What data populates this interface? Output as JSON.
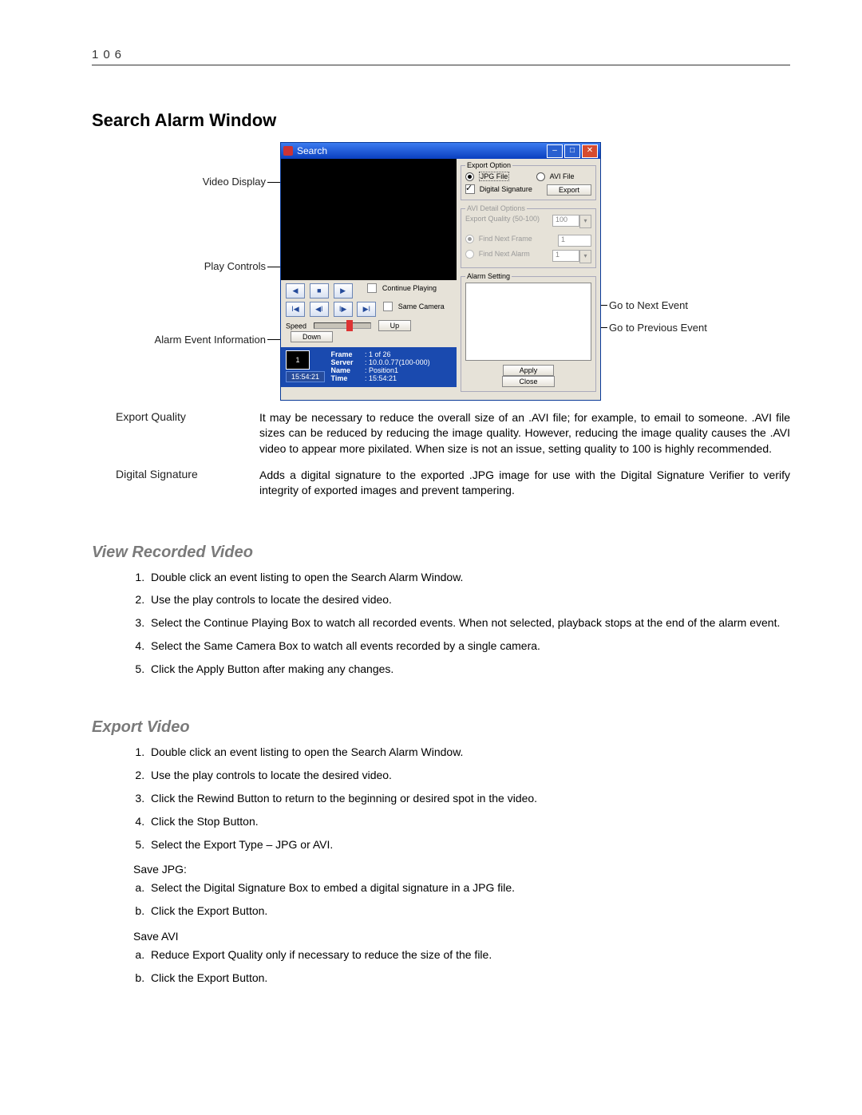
{
  "page_number": "106",
  "section_title": "Search Alarm Window",
  "callouts": {
    "video_display": "Video Display",
    "play_controls": "Play Controls",
    "alarm_event_info": "Alarm Event Information",
    "go_next": "Go to Next Event",
    "go_prev": "Go to Previous Event"
  },
  "window": {
    "title": "Search",
    "export_option": {
      "legend": "Export Option",
      "jpg": "JPG File",
      "avi": "AVI File",
      "digital_signature": "Digital Signature",
      "export_btn": "Export"
    },
    "avi_detail": {
      "legend": "AVI Detail Options",
      "quality_label": "Export Quality (50-100)",
      "quality_value": "100",
      "find_frame": "Find Next Frame",
      "find_frame_val": "1",
      "find_alarm": "Find Next Alarm",
      "find_alarm_val": "1"
    },
    "alarm_setting_legend": "Alarm Setting",
    "apply": "Apply",
    "close": "Close",
    "play": {
      "continue": "Continue Playing",
      "same_camera": "Same Camera",
      "speed": "Speed",
      "up": "Up",
      "down": "Down"
    },
    "info": {
      "thumb": "1",
      "time_big": "15:54:21",
      "frame_k": "Frame",
      "frame_v": "1 of 26",
      "server_k": "Server",
      "server_v": "10.0.0.77(100-000)",
      "name_k": "Name",
      "name_v": "Position1",
      "time_k": "Time",
      "time_v": "15:54:21"
    }
  },
  "definitions": {
    "export_quality_term": "Export Quality",
    "export_quality_desc": "It may be necessary to reduce the overall size of an .AVI file; for example, to email to someone. .AVI file sizes can be reduced by reducing the image quality.  However, reducing the image quality causes the .AVI video to appear more pixilated.  When size is not an issue, setting quality to 100 is highly recommended.",
    "digital_sig_term": "Digital Signature",
    "digital_sig_desc": "Adds a digital signature to the exported .JPG image for use with the Digital Signature Verifier to verify integrity of exported images and prevent tampering."
  },
  "view_recorded": {
    "heading": "View Recorded Video",
    "steps": [
      "Double click an event listing to open the Search Alarm Window.",
      "Use the play controls to locate the desired video.",
      "Select the Continue Playing Box to watch all recorded events.  When not selected, playback stops at the end of the alarm event.",
      "Select the Same Camera Box to watch all events recorded by a single camera.",
      "Click the Apply Button after making any changes."
    ]
  },
  "export_video": {
    "heading": "Export Video",
    "steps": [
      "Double click an event listing to open the Search Alarm Window.",
      "Use the play controls to locate the desired video.",
      "Click the Rewind Button to return to the beginning or desired spot in the video.",
      "Click the Stop Button.",
      "Select the Export Type – JPG or AVI."
    ],
    "save_jpg_label": "Save JPG:",
    "save_jpg_steps": [
      "Select the Digital Signature Box to embed a digital signature in a JPG file.",
      "Click the Export Button."
    ],
    "save_avi_label": "Save AVI",
    "save_avi_steps": [
      "Reduce Export Quality only if necessary to reduce the size of the file.",
      "Click the Export Button."
    ]
  }
}
